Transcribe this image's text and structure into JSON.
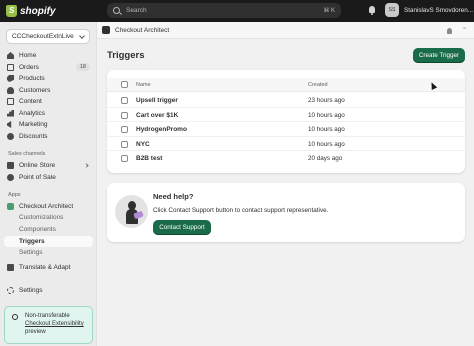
{
  "topbar": {
    "brand": "shopify",
    "search_placeholder": "Search",
    "search_shortcut": "⌘ K",
    "user_initials": "SS",
    "user_name": "StanislavS Smovdoren..."
  },
  "sidebar": {
    "store_name": "CCCheckoutExtnLive",
    "items": [
      {
        "label": "Home",
        "icon": "home-icon"
      },
      {
        "label": "Orders",
        "icon": "orders-icon",
        "badge": "18"
      },
      {
        "label": "Products",
        "icon": "products-icon"
      },
      {
        "label": "Customers",
        "icon": "customers-icon"
      },
      {
        "label": "Content",
        "icon": "content-icon"
      },
      {
        "label": "Analytics",
        "icon": "analytics-icon"
      },
      {
        "label": "Marketing",
        "icon": "marketing-icon"
      },
      {
        "label": "Discounts",
        "icon": "discounts-icon"
      }
    ],
    "sales_channels_label": "Sales channels",
    "sales_channels": [
      {
        "label": "Online Store",
        "icon": "online-store-icon"
      },
      {
        "label": "Point of Sale",
        "icon": "point-of-sale-icon"
      }
    ],
    "apps_label": "Apps",
    "app_name": "Checkout Architect",
    "app_subitems": [
      "Customizations",
      "Components",
      "Triggers",
      "Settings"
    ],
    "active_subitem": "Triggers",
    "translate_label": "Translate & Adapt",
    "settings_label": "Settings",
    "notice": {
      "line1": "Non-transferable",
      "link": "Checkout Extensibility",
      "line3": "preview"
    }
  },
  "appbar": {
    "title": "Checkout Architect"
  },
  "main": {
    "title": "Triggers",
    "create_button": "Create Trigger",
    "table": {
      "columns": [
        "Name",
        "Created"
      ],
      "rows": [
        {
          "name": "Upsell trigger",
          "created": "23 hours ago"
        },
        {
          "name": "Cart over $1K",
          "created": "10 hours ago"
        },
        {
          "name": "HydrogenPromo",
          "created": "10 hours ago"
        },
        {
          "name": "NYC",
          "created": "10 hours ago"
        },
        {
          "name": "B2B test",
          "created": "20 days ago"
        }
      ]
    },
    "help": {
      "title": "Need help?",
      "text": "Click Contact Support button to contact support representative.",
      "button": "Contact Support"
    }
  },
  "colors": {
    "topbar_bg": "#1a1a1a",
    "primary_green": "#1a6b4a",
    "page_bg": "#f1f1f1",
    "notice_bg": "#e0f5f0"
  }
}
